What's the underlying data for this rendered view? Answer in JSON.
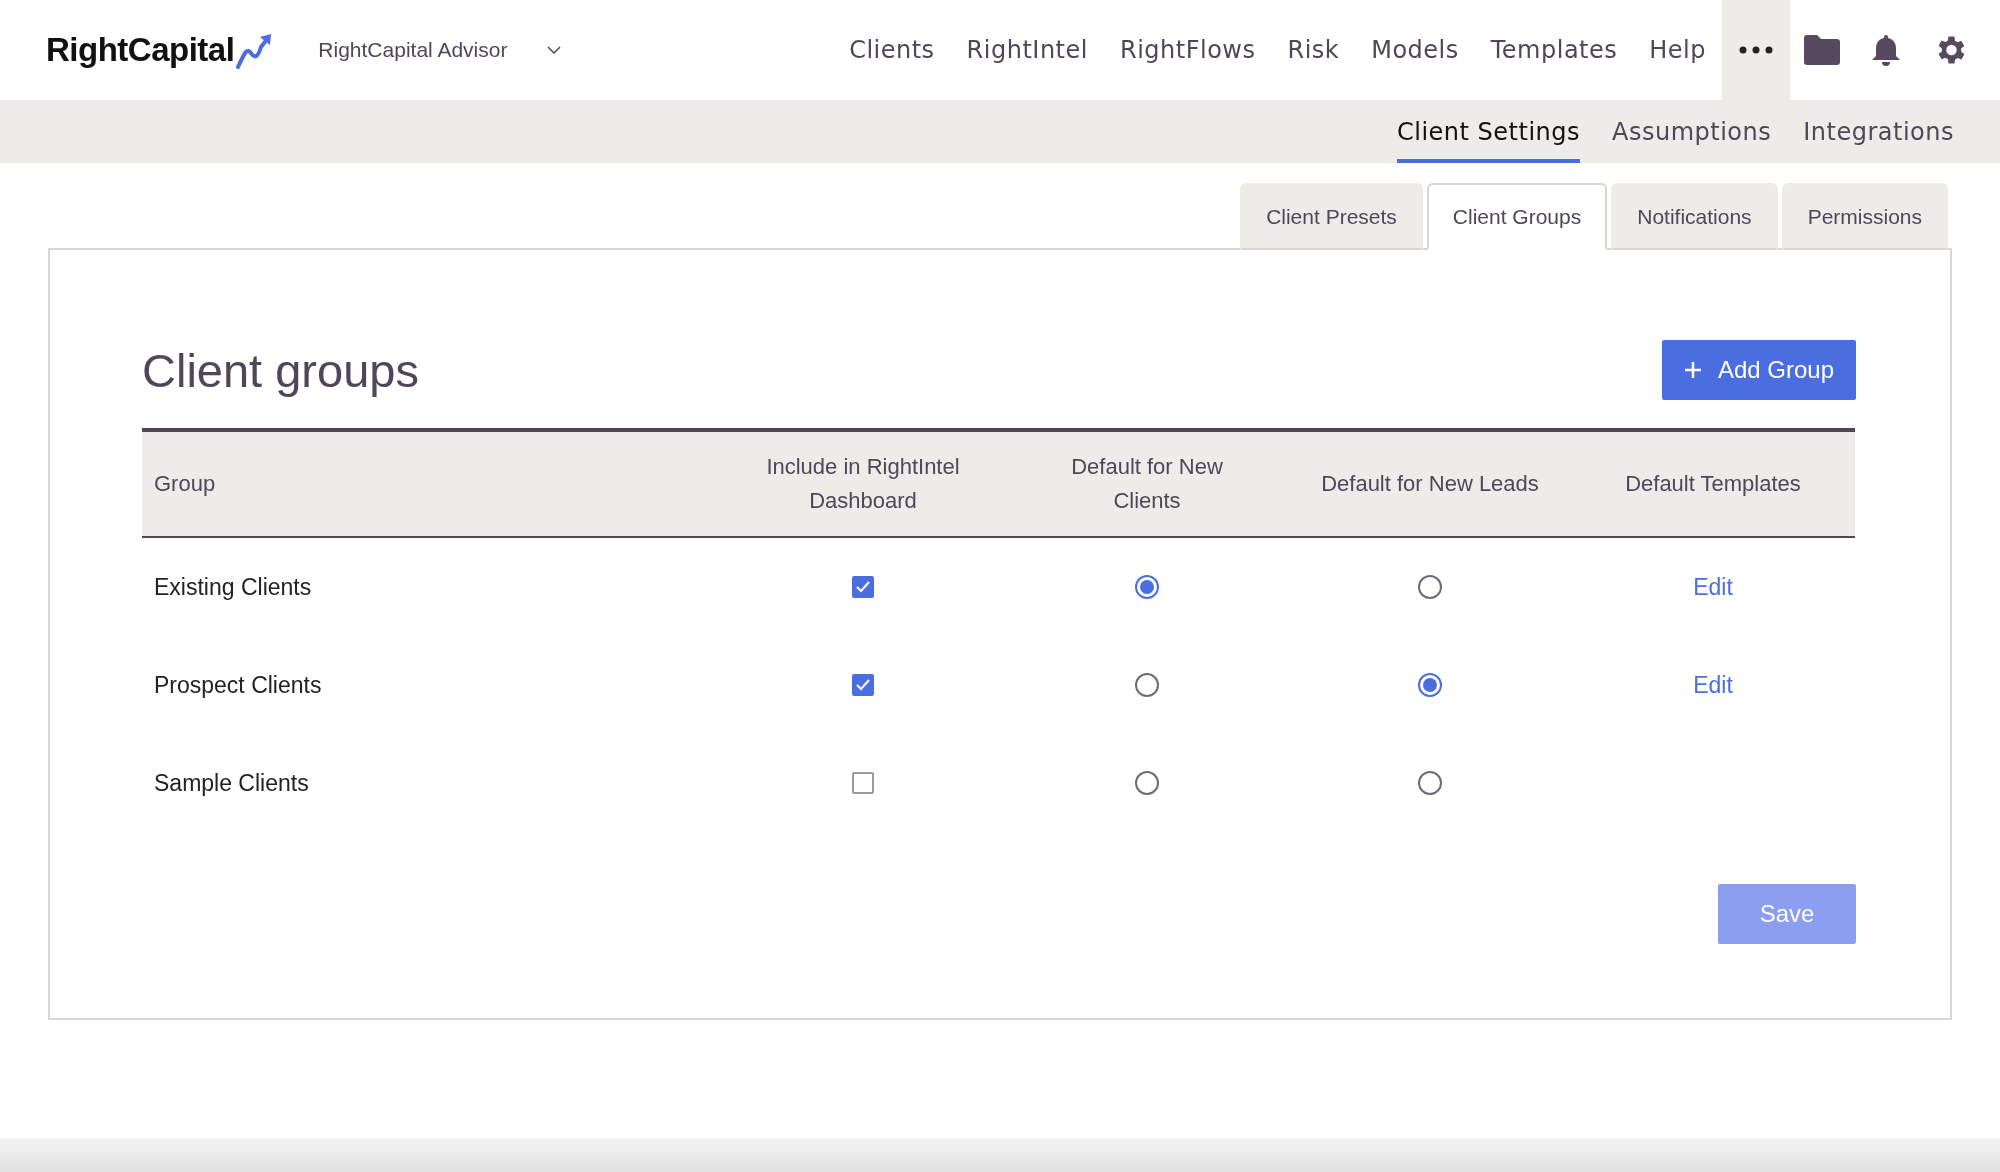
{
  "header": {
    "logo": "RightCapital",
    "account": {
      "label": "RightCapital Advisor"
    },
    "nav": [
      {
        "label": "Clients"
      },
      {
        "label": "RightIntel"
      },
      {
        "label": "RightFlows"
      },
      {
        "label": "Risk"
      },
      {
        "label": "Models"
      },
      {
        "label": "Templates"
      },
      {
        "label": "Help"
      }
    ]
  },
  "settings_tabs": [
    {
      "label": "Client Settings",
      "selected": true
    },
    {
      "label": "Assumptions",
      "selected": false
    },
    {
      "label": "Integrations",
      "selected": false
    }
  ],
  "sub_tabs": [
    {
      "label": "Client Presets",
      "selected": false
    },
    {
      "label": "Client Groups",
      "selected": true
    },
    {
      "label": "Notifications",
      "selected": false
    },
    {
      "label": "Permissions",
      "selected": false
    }
  ],
  "page": {
    "title": "Client groups",
    "add_button": "Add Group",
    "save_button": {
      "label": "Save",
      "disabled": true
    }
  },
  "table": {
    "columns": [
      "Group",
      "Include in RightIntel Dashboard",
      "Default for New Clients",
      "Default for New Leads",
      "Default Templates"
    ],
    "rows": [
      {
        "group": "Existing Clients",
        "include": true,
        "default_clients": true,
        "default_leads": false,
        "templates": "Edit"
      },
      {
        "group": "Prospect Clients",
        "include": true,
        "default_clients": false,
        "default_leads": true,
        "templates": "Edit"
      },
      {
        "group": "Sample Clients",
        "include": false,
        "default_clients": false,
        "default_leads": false
      }
    ]
  }
}
